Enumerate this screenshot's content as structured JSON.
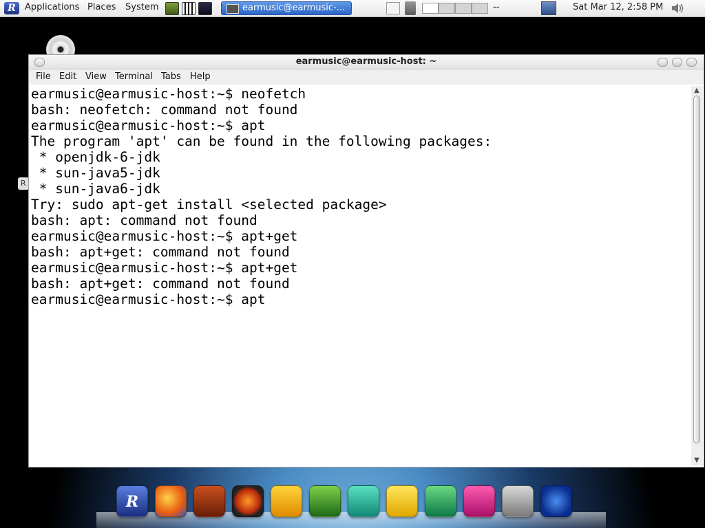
{
  "top_panel": {
    "menus": [
      "Applications",
      "Places",
      "System"
    ],
    "taskbar_window_label": "earmusic@earmusic-...",
    "workspace_extra": "--",
    "clock": "Sat Mar 12,  2:58 PM",
    "icons": [
      "app-logo-icon",
      "monitor-launcher-icon",
      "keyboard-launcher-icon",
      "audio-launcher-icon",
      "show-desktop-icon",
      "trash-icon",
      "volume-icon",
      "network-icon"
    ]
  },
  "desktop": {
    "icon_label_fragment": "R"
  },
  "terminal": {
    "title": "earmusic@earmusic-host: ~",
    "menu": [
      "File",
      "Edit",
      "View",
      "Terminal",
      "Tabs",
      "Help"
    ],
    "lines": [
      "earmusic@earmusic-host:~$ neofetch",
      "bash: neofetch: command not found",
      "earmusic@earmusic-host:~$ apt",
      "The program 'apt' can be found in the following packages:",
      " * openjdk-6-jdk",
      " * sun-java5-jdk",
      " * sun-java6-jdk",
      "Try: sudo apt-get install <selected package>",
      "bash: apt: command not found",
      "earmusic@earmusic-host:~$ apt+get",
      "bash: apt+get: command not found",
      "earmusic@earmusic-host:~$ apt+get",
      "bash: apt+get: command not found",
      "earmusic@earmusic-host:~$ apt"
    ]
  },
  "dock": {
    "items": [
      "app-logo-dock-icon",
      "browser-dock-icon",
      "guitar-dock-icon",
      "burner-dock-icon",
      "coffee-dock-icon",
      "photo-editor-dock-icon",
      "messenger-dock-icon",
      "office-dock-icon",
      "drawing-dock-icon",
      "music-dock-icon",
      "settings-dock-icon",
      "power-dock-icon"
    ],
    "logo_letter": "R"
  }
}
